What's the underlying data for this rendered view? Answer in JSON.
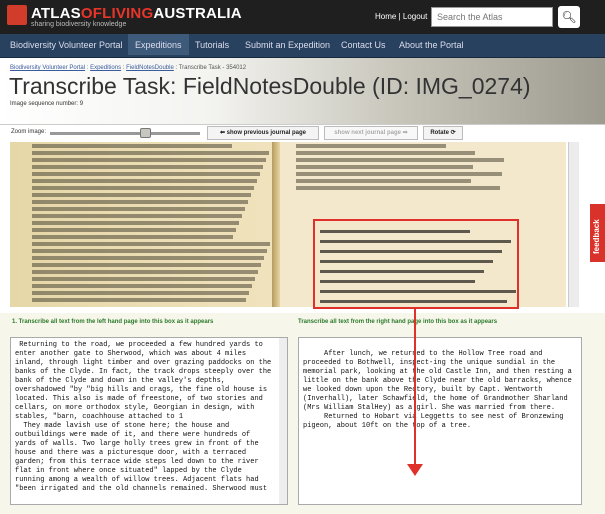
{
  "brand": {
    "name_part1": "ATLAS",
    "name_part2": "OF",
    "name_part3": "LIVING",
    "name_part4": "AUSTRALIA",
    "tagline": "sharing biodiversity knowledge"
  },
  "toplinks": {
    "home": "Home",
    "sep": " | ",
    "logout": "Logout"
  },
  "search": {
    "placeholder": "Search the Atlas"
  },
  "nav": [
    "Biodiversity Volunteer Portal",
    "Expeditions",
    "Tutorials",
    "Submit an Expedition",
    "Contact Us",
    "About the Portal"
  ],
  "breadcrumb": {
    "a": "Biodiversity Volunteer Portal",
    "b": "Expeditions",
    "c": "FieldNotesDouble",
    "d": "Transcribe Task - 354012"
  },
  "page_title": "Transcribe Task: FieldNotesDouble (ID: IMG_0274)",
  "sequence": "Image sequence number: 9",
  "zoom_label": "Zoom image:",
  "buttons": {
    "prev": "show previous journal page",
    "next": "show next journal page",
    "rotate": "Rotate"
  },
  "feedback": "feedback",
  "left_label": "1. Transcribe all text from the left hand page into this box as it appears",
  "right_label": "Transcribe all text from the right hand page into this box as it appears",
  "left_text": " Returning to the road, we proceeded a few hundred yards to enter another gate to Sherwood, which was about 4 miles inland, through light timber and over grazing paddocks on the banks of the Clyde. In fact, the track drops steeply over the bank of the Clyde and down in the valley's depths, overshadowed \"by \"big hills and crags, the fine old house is located. This also is made of freestone, of two stories and cellars, on more orthodox style, Georgian in design, with stables, \"barn, coachhouse attached to 1\n  They made lavish use of stone here; the house and outbuildings were made of it, and there were hundreds of yards of walls. Two large holly trees grew in front of the house and there was a picturesque door, with a terraced garden; from this terrace wide steps led down to the river flat in front where once situated\" lapped by the Clyde running among a wealth of willow trees. Adjacent flats had \"been irrigated and the old channels remained. Sherwood must",
  "right_text": "\n     After lunch, we returned to the Hollow Tree road and proceeded to Bothwell, inspect-ing the unique sundial in the memorial park, looking at the old Castle Inn, and then resting a little on the bank above the Clyde near the old barracks, whence we looked down upon the Rectory, built by Capt. Wentworth (Inverhall), later Schawfield, the home of Grandmother Sharland (Mrs William StalHey) as a girl. She was married from there.\n     Returned to Hobart via Leggetts to see nest of Bronzewing pigeon, about 10ft on the top of a tree."
}
